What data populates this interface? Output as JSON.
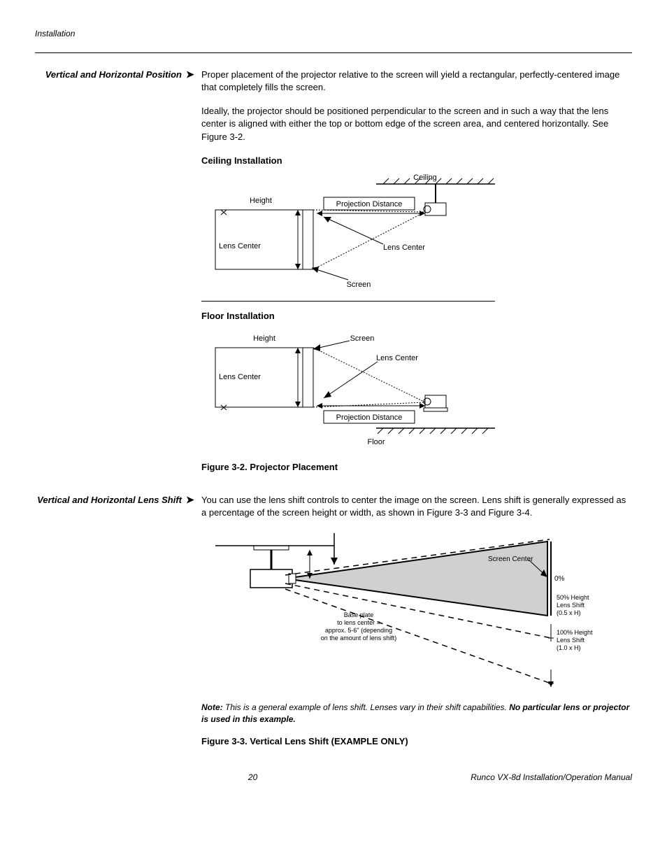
{
  "header": "Installation",
  "sections": {
    "position": {
      "label": "Vertical and Horizontal Position",
      "p1": "Proper placement of the projector relative to the screen will yield a rectangular, perfectly-centered image that completely fills the screen.",
      "p2": "Ideally, the projector should be positioned perpendicular to the screen and in such a way that the lens center is aligned with either the top or bottom edge of the screen area, and centered horizontally. See Figure 3-2."
    },
    "diagram1": {
      "ceilingTitle": "Ceiling Installation",
      "floorTitle": "Floor Installation",
      "labels": {
        "ceiling": "Ceiling",
        "height": "Height",
        "projDist": "Projection Distance",
        "lensCenter": "Lens Center",
        "screen": "Screen",
        "floor": "Floor"
      },
      "caption": "Figure 3-2. Projector Placement"
    },
    "lensShift": {
      "label": "Vertical and Horizontal Lens Shift",
      "p1": "You can use the lens shift controls to center the image on the screen. Lens shift is generally expressed as a percentage of the screen height or width, as shown in Figure 3-3 and Figure 3-4."
    },
    "diagram2": {
      "labels": {
        "screenCenter": "Screen Center",
        "zero": "0%",
        "fifty1": "50% Height",
        "fifty2": "Lens Shift",
        "fifty3": "(0.5 x H)",
        "hundred1": "100% Height",
        "hundred2": "Lens Shift",
        "hundred3": "(1.0 x H)",
        "bp1": "Base plate",
        "bp2": "to lens center =",
        "bp3": "approx. 5-6\" (depending",
        "bp4": "on the amount of lens shift)"
      },
      "noteBold1": "Note:",
      "noteText": " This is a general example of lens shift. Lenses vary in their shift capabilities. ",
      "noteBold2": "No particular lens or projector is used in this example.",
      "caption": "Figure 3-3. Vertical Lens Shift (EXAMPLE ONLY)"
    }
  },
  "footer": {
    "page": "20",
    "doc": "Runco VX-8d Installation/Operation Manual"
  }
}
